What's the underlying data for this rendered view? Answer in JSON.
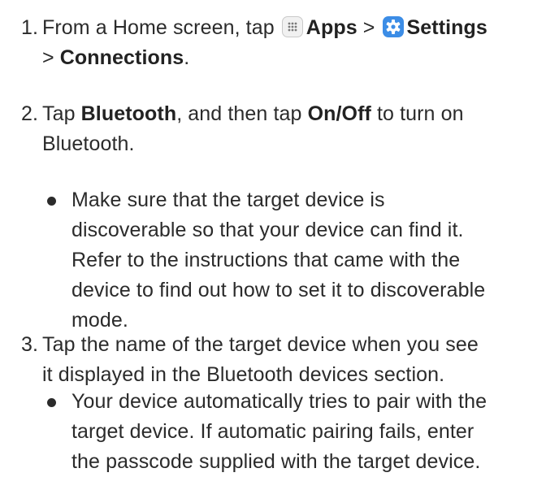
{
  "steps": [
    {
      "number": "1.",
      "line1_prefix": "From a Home screen, tap",
      "apps_label": "Apps",
      "separator1": ">",
      "settings_label": "Settings",
      "separator2": ">",
      "connections_label": "Connections",
      "end": "."
    },
    {
      "number": "2.",
      "text_a": "Tap",
      "bluetooth_label": "Bluetooth",
      "text_b": ", and then tap",
      "onoff_label": "On/Off",
      "text_c": "to turn on",
      "text_d": "Bluetooth.",
      "bullet": [
        "Make sure that the target device is",
        "discoverable so that your device can find it.",
        "Refer to the instructions that came with the",
        "device to find out how to set it to discoverable",
        "mode."
      ]
    },
    {
      "number": "3.",
      "lines": [
        "Tap the name of the target device when you see",
        "it displayed in the Bluetooth devices section."
      ],
      "bullet": [
        "Your device automatically tries to pair with the",
        "target device. If automatic pairing fails, enter",
        "the passcode supplied with the target device."
      ]
    }
  ],
  "icons": {
    "apps": "apps-grid-icon",
    "settings": "settings-gear-icon",
    "settings_color": "#3c8de6"
  }
}
